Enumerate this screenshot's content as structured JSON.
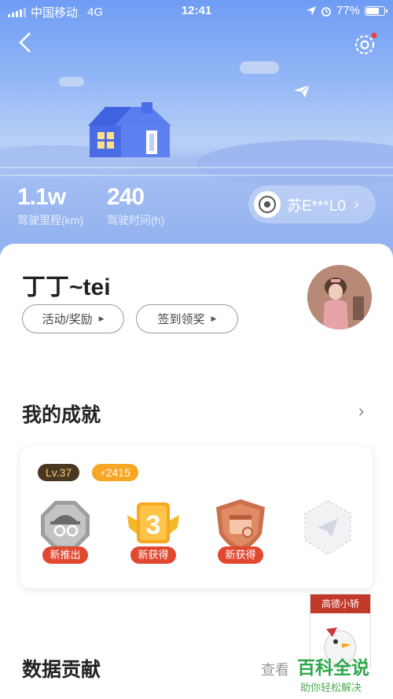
{
  "status_bar": {
    "carrier": "中国移动",
    "network": "4G",
    "time": "12:41",
    "battery": "77%",
    "battery_level": 0.77
  },
  "header": {
    "back_icon": "chevron-left-icon",
    "settings_icon": "gear-icon"
  },
  "stats": [
    {
      "value": "1.1w",
      "label": "驾驶里程(km)"
    },
    {
      "value": "240",
      "label": "驾驶时间(h)"
    }
  ],
  "car_chip": {
    "plate": "苏E***L0"
  },
  "profile": {
    "name": "丁丁~tei",
    "buttons": [
      {
        "label": "活动/奖励"
      },
      {
        "label": "签到领奖"
      }
    ]
  },
  "achievements": {
    "title": "我的成就",
    "level": "Lv.37",
    "points": "2415",
    "medals": [
      {
        "tag": "新推出",
        "icon": "detective-badge-icon"
      },
      {
        "tag": "新获得",
        "icon": "number-3-badge-icon"
      },
      {
        "tag": "新获得",
        "icon": "calendar-shield-icon"
      },
      {
        "tag": "",
        "icon": "paper-plane-badge-icon"
      }
    ]
  },
  "data_section": {
    "title": "数据贡献",
    "link": "查看"
  },
  "ad_banner": {
    "title": "高德小轿"
  },
  "watermark": {
    "big": "百科全说",
    "small": "助你轻松解决"
  },
  "colors": {
    "hero_top": "#6f9cf4",
    "level_badge": "#4a3722",
    "points_badge": "#f6a623",
    "medal_tag": "#e2472f"
  }
}
